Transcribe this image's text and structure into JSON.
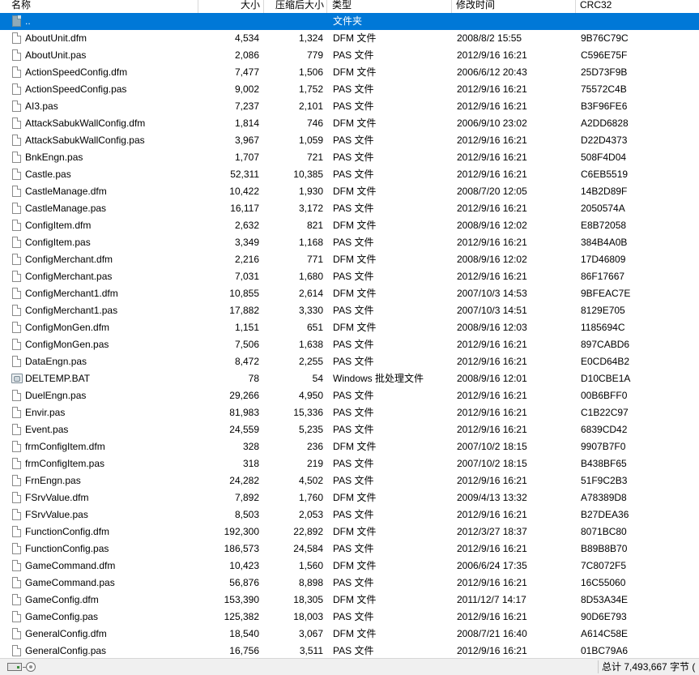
{
  "columns": {
    "name": "名称",
    "size": "大小",
    "packed": "压缩后大小",
    "type": "类型",
    "modified": "修改时间",
    "crc": "CRC32"
  },
  "parent_row": {
    "name": "..",
    "type": "文件夹"
  },
  "files": [
    {
      "name": "AboutUnit.dfm",
      "size": "4,534",
      "packed": "1,324",
      "type": "DFM 文件",
      "modified": "2008/8/2 15:55",
      "crc": "9B76C79C"
    },
    {
      "name": "AboutUnit.pas",
      "size": "2,086",
      "packed": "779",
      "type": "PAS 文件",
      "modified": "2012/9/16 16:21",
      "crc": "C596E75F"
    },
    {
      "name": "ActionSpeedConfig.dfm",
      "size": "7,477",
      "packed": "1,506",
      "type": "DFM 文件",
      "modified": "2006/6/12 20:43",
      "crc": "25D73F9B"
    },
    {
      "name": "ActionSpeedConfig.pas",
      "size": "9,002",
      "packed": "1,752",
      "type": "PAS 文件",
      "modified": "2012/9/16 16:21",
      "crc": "75572C4B"
    },
    {
      "name": "AI3.pas",
      "size": "7,237",
      "packed": "2,101",
      "type": "PAS 文件",
      "modified": "2012/9/16 16:21",
      "crc": "B3F96FE6"
    },
    {
      "name": "AttackSabukWallConfig.dfm",
      "size": "1,814",
      "packed": "746",
      "type": "DFM 文件",
      "modified": "2006/9/10 23:02",
      "crc": "A2DD6828"
    },
    {
      "name": "AttackSabukWallConfig.pas",
      "size": "3,967",
      "packed": "1,059",
      "type": "PAS 文件",
      "modified": "2012/9/16 16:21",
      "crc": "D22D4373"
    },
    {
      "name": "BnkEngn.pas",
      "size": "1,707",
      "packed": "721",
      "type": "PAS 文件",
      "modified": "2012/9/16 16:21",
      "crc": "508F4D04"
    },
    {
      "name": "Castle.pas",
      "size": "52,311",
      "packed": "10,385",
      "type": "PAS 文件",
      "modified": "2012/9/16 16:21",
      "crc": "C6EB5519"
    },
    {
      "name": "CastleManage.dfm",
      "size": "10,422",
      "packed": "1,930",
      "type": "DFM 文件",
      "modified": "2008/7/20 12:05",
      "crc": "14B2D89F"
    },
    {
      "name": "CastleManage.pas",
      "size": "16,117",
      "packed": "3,172",
      "type": "PAS 文件",
      "modified": "2012/9/16 16:21",
      "crc": "2050574A"
    },
    {
      "name": "ConfigItem.dfm",
      "size": "2,632",
      "packed": "821",
      "type": "DFM 文件",
      "modified": "2008/9/16 12:02",
      "crc": "E8B72058"
    },
    {
      "name": "ConfigItem.pas",
      "size": "3,349",
      "packed": "1,168",
      "type": "PAS 文件",
      "modified": "2012/9/16 16:21",
      "crc": "384B4A0B"
    },
    {
      "name": "ConfigMerchant.dfm",
      "size": "2,216",
      "packed": "771",
      "type": "DFM 文件",
      "modified": "2008/9/16 12:02",
      "crc": "17D46809"
    },
    {
      "name": "ConfigMerchant.pas",
      "size": "7,031",
      "packed": "1,680",
      "type": "PAS 文件",
      "modified": "2012/9/16 16:21",
      "crc": "86F17667"
    },
    {
      "name": "ConfigMerchant1.dfm",
      "size": "10,855",
      "packed": "2,614",
      "type": "DFM 文件",
      "modified": "2007/10/3 14:53",
      "crc": "9BFEAC7E"
    },
    {
      "name": "ConfigMerchant1.pas",
      "size": "17,882",
      "packed": "3,330",
      "type": "PAS 文件",
      "modified": "2007/10/3 14:51",
      "crc": "8129E705"
    },
    {
      "name": "ConfigMonGen.dfm",
      "size": "1,151",
      "packed": "651",
      "type": "DFM 文件",
      "modified": "2008/9/16 12:03",
      "crc": "1185694C"
    },
    {
      "name": "ConfigMonGen.pas",
      "size": "7,506",
      "packed": "1,638",
      "type": "PAS 文件",
      "modified": "2012/9/16 16:21",
      "crc": "897CABD6"
    },
    {
      "name": "DataEngn.pas",
      "size": "8,472",
      "packed": "2,255",
      "type": "PAS 文件",
      "modified": "2012/9/16 16:21",
      "crc": "E0CD64B2"
    },
    {
      "name": "DELTEMP.BAT",
      "size": "78",
      "packed": "54",
      "type": "Windows 批处理文件",
      "modified": "2008/9/16 12:01",
      "crc": "D10CBE1A",
      "icon": "bat"
    },
    {
      "name": "DuelEngn.pas",
      "size": "29,266",
      "packed": "4,950",
      "type": "PAS 文件",
      "modified": "2012/9/16 16:21",
      "crc": "00B6BFF0"
    },
    {
      "name": "Envir.pas",
      "size": "81,983",
      "packed": "15,336",
      "type": "PAS 文件",
      "modified": "2012/9/16 16:21",
      "crc": "C1B22C97"
    },
    {
      "name": "Event.pas",
      "size": "24,559",
      "packed": "5,235",
      "type": "PAS 文件",
      "modified": "2012/9/16 16:21",
      "crc": "6839CD42"
    },
    {
      "name": "frmConfigItem.dfm",
      "size": "328",
      "packed": "236",
      "type": "DFM 文件",
      "modified": "2007/10/2 18:15",
      "crc": "9907B7F0"
    },
    {
      "name": "frmConfigItem.pas",
      "size": "318",
      "packed": "219",
      "type": "PAS 文件",
      "modified": "2007/10/2 18:15",
      "crc": "B438BF65"
    },
    {
      "name": "FrnEngn.pas",
      "size": "24,282",
      "packed": "4,502",
      "type": "PAS 文件",
      "modified": "2012/9/16 16:21",
      "crc": "51F9C2B3"
    },
    {
      "name": "FSrvValue.dfm",
      "size": "7,892",
      "packed": "1,760",
      "type": "DFM 文件",
      "modified": "2009/4/13 13:32",
      "crc": "A78389D8"
    },
    {
      "name": "FSrvValue.pas",
      "size": "8,503",
      "packed": "2,053",
      "type": "PAS 文件",
      "modified": "2012/9/16 16:21",
      "crc": "B27DEA36"
    },
    {
      "name": "FunctionConfig.dfm",
      "size": "192,300",
      "packed": "22,892",
      "type": "DFM 文件",
      "modified": "2012/3/27 18:37",
      "crc": "8071BC80"
    },
    {
      "name": "FunctionConfig.pas",
      "size": "186,573",
      "packed": "24,584",
      "type": "PAS 文件",
      "modified": "2012/9/16 16:21",
      "crc": "B89B8B70"
    },
    {
      "name": "GameCommand.dfm",
      "size": "10,423",
      "packed": "1,560",
      "type": "DFM 文件",
      "modified": "2006/6/24 17:35",
      "crc": "7C8072F5"
    },
    {
      "name": "GameCommand.pas",
      "size": "56,876",
      "packed": "8,898",
      "type": "PAS 文件",
      "modified": "2012/9/16 16:21",
      "crc": "16C55060"
    },
    {
      "name": "GameConfig.dfm",
      "size": "153,390",
      "packed": "18,305",
      "type": "DFM 文件",
      "modified": "2011/12/7 14:17",
      "crc": "8D53A34E"
    },
    {
      "name": "GameConfig.pas",
      "size": "125,382",
      "packed": "18,003",
      "type": "PAS 文件",
      "modified": "2012/9/16 16:21",
      "crc": "90D6E793"
    },
    {
      "name": "GeneralConfig.dfm",
      "size": "18,540",
      "packed": "3,067",
      "type": "DFM 文件",
      "modified": "2008/7/21 16:40",
      "crc": "A614C58E"
    },
    {
      "name": "GeneralConfig.pas",
      "size": "16,756",
      "packed": "3,511",
      "type": "PAS 文件",
      "modified": "2012/9/16 16:21",
      "crc": "01BC79A6"
    }
  ],
  "status": {
    "total": "总计 7,493,667 字节 ("
  },
  "icons": {
    "file": "file-icon",
    "batch": "batch-file-icon",
    "parent": "parent-folder-icon",
    "drive": "drive-icon"
  },
  "colors": {
    "selection": "#0078d7",
    "status_background": "#f0f0f0"
  }
}
